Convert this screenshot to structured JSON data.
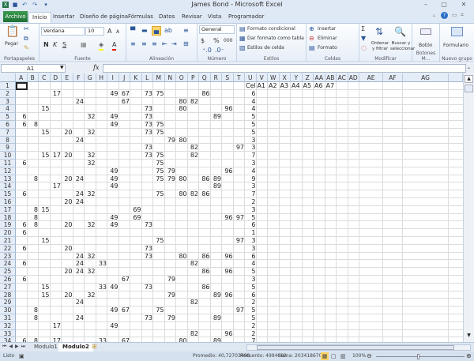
{
  "window": {
    "title": "James Bond - Microsoft Excel"
  },
  "tabs": {
    "file": "Archivo",
    "items": [
      "Inicio",
      "Insertar",
      "Diseño de página",
      "Fórmulas",
      "Datos",
      "Revisar",
      "Vista",
      "Programador"
    ],
    "selected": "Inicio"
  },
  "ribbon": {
    "clipboard": {
      "label": "Portapapeles",
      "paste": "Pegar"
    },
    "font": {
      "label": "Fuente",
      "name": "Verdana",
      "size": "10",
      "bold": "N",
      "italic": "K",
      "underline": "S"
    },
    "alignment": {
      "label": "Alineación"
    },
    "number": {
      "label": "Número",
      "format": "General",
      "currency": "$",
      "percent": "%",
      "thousands": "000"
    },
    "styles": {
      "label": "Estilos",
      "conditional": "Formato condicional",
      "table": "Dar formato como tabla",
      "cell": "Estilos de celda"
    },
    "cells": {
      "label": "Celdas",
      "insert": "Insertar",
      "delete": "Eliminar",
      "format": "Formato"
    },
    "editing": {
      "label": "Modificar",
      "sum": "Σ",
      "sort": "Ordenar y filtrar",
      "find": "Buscar y seleccionar"
    },
    "buttons": {
      "label": "Botones M...",
      "button": "Botón"
    },
    "newgroup": {
      "label": "Nuevo grupo",
      "form": "Formulario"
    }
  },
  "formula_bar": {
    "name_box": "A1",
    "fx": "fx",
    "value": ""
  },
  "columns": [
    "A",
    "B",
    "C",
    "D",
    "E",
    "F",
    "G",
    "H",
    "I",
    "J",
    "K",
    "L",
    "M",
    "N",
    "O",
    "P",
    "Q",
    "R",
    "S",
    "T",
    "U",
    "V",
    "W",
    "X",
    "Y",
    "Z",
    "AA",
    "AB",
    "AC",
    "AD",
    "AE",
    "AF",
    "AG"
  ],
  "value_columns": {
    "6": "A",
    "8": "B",
    "15": "C",
    "17": "D",
    "20": "E",
    "24": "F",
    "32": "G",
    "33": "H",
    "49": "I",
    "67": "J",
    "69": "K",
    "73": "L",
    "75": "M",
    "79": "N",
    "80": "O",
    "82": "P",
    "86": "Q",
    "89": "R",
    "96": "S",
    "97": "T"
  },
  "header_row": {
    "U": "Cel",
    "V": "A1",
    "W": "A2",
    "X": "A3",
    "Y": "A4",
    "Z": "A5",
    "AA": "A6",
    "AB": "A7"
  },
  "rows": [
    {
      "n": 2,
      "v": [
        17,
        49,
        67,
        73,
        75,
        86
      ],
      "c": 6
    },
    {
      "n": 3,
      "v": [
        24,
        67,
        80,
        82
      ],
      "c": 4
    },
    {
      "n": 4,
      "v": [
        15,
        73,
        80,
        96
      ],
      "c": 4
    },
    {
      "n": 5,
      "v": [
        6,
        32,
        49,
        73,
        89
      ],
      "c": 5
    },
    {
      "n": 6,
      "v": [
        6,
        8,
        49,
        73,
        75
      ],
      "c": 5
    },
    {
      "n": 7,
      "v": [
        15,
        20,
        32,
        73,
        75
      ],
      "c": 5
    },
    {
      "n": 8,
      "v": [
        24,
        79,
        80
      ],
      "c": 3
    },
    {
      "n": 9,
      "v": [
        73,
        82,
        97
      ],
      "c": 3
    },
    {
      "n": 10,
      "v": [
        15,
        17,
        20,
        32,
        73,
        75,
        82
      ],
      "c": 7
    },
    {
      "n": 11,
      "v": [
        6,
        32,
        75
      ],
      "c": 3
    },
    {
      "n": 12,
      "v": [
        49,
        75,
        79,
        96
      ],
      "c": 4
    },
    {
      "n": 13,
      "v": [
        8,
        20,
        24,
        49,
        75,
        79,
        80,
        86,
        89
      ],
      "c": 9
    },
    {
      "n": 14,
      "v": [
        17,
        49,
        89
      ],
      "c": 3
    },
    {
      "n": 15,
      "v": [
        6,
        24,
        32,
        75,
        80,
        82,
        86
      ],
      "c": 7
    },
    {
      "n": 16,
      "v": [
        20,
        24
      ],
      "c": 2
    },
    {
      "n": 17,
      "v": [
        8,
        15,
        69
      ],
      "c": 3
    },
    {
      "n": 18,
      "v": [
        8,
        49,
        69,
        96,
        97
      ],
      "c": 5
    },
    {
      "n": 19,
      "v": [
        6,
        8,
        20,
        32,
        49,
        73
      ],
      "c": 6
    },
    {
      "n": 20,
      "v": [
        6
      ],
      "c": 1
    },
    {
      "n": 21,
      "v": [
        15,
        75,
        97
      ],
      "c": 3
    },
    {
      "n": 22,
      "v": [
        6,
        20,
        73
      ],
      "c": 3
    },
    {
      "n": 23,
      "v": [
        24,
        32,
        73,
        80,
        86,
        96
      ],
      "c": 6
    },
    {
      "n": 24,
      "v": [
        6,
        24,
        33,
        82
      ],
      "c": 4
    },
    {
      "n": 25,
      "v": [
        20,
        24,
        32,
        86,
        96
      ],
      "c": 5
    },
    {
      "n": 26,
      "v": [
        6,
        67,
        79
      ],
      "c": 3
    },
    {
      "n": 27,
      "v": [
        15,
        33,
        49,
        73,
        86
      ],
      "c": 5
    },
    {
      "n": 28,
      "v": [
        15,
        20,
        32,
        79,
        89,
        96
      ],
      "c": 6
    },
    {
      "n": 29,
      "v": [
        24,
        82
      ],
      "c": 2
    },
    {
      "n": 30,
      "v": [
        8,
        49,
        67,
        75,
        97
      ],
      "c": 5
    },
    {
      "n": 31,
      "v": [
        8,
        24,
        73,
        79,
        89
      ],
      "c": 5
    },
    {
      "n": 32,
      "v": [
        17,
        49
      ],
      "c": 2
    },
    {
      "n": 33,
      "v": [
        82,
        96
      ],
      "c": 2
    },
    {
      "n": 34,
      "v": [
        6,
        8,
        17,
        33,
        67,
        80,
        89
      ],
      "c": 7
    }
  ],
  "sheets": {
    "items": [
      "Modulo1",
      "Modulo2"
    ],
    "selected": "Modulo2"
  },
  "status": {
    "ready": "Listo",
    "average": "Promedio: 40,72703498",
    "count": "Recuento: 4994692",
    "sum": "Suma: 203418670",
    "zoom": "100%"
  },
  "colors": {
    "file_tab": "#217346",
    "header_bg": "#e4ecf7",
    "ribbon_bg": "#dfe9f5"
  }
}
